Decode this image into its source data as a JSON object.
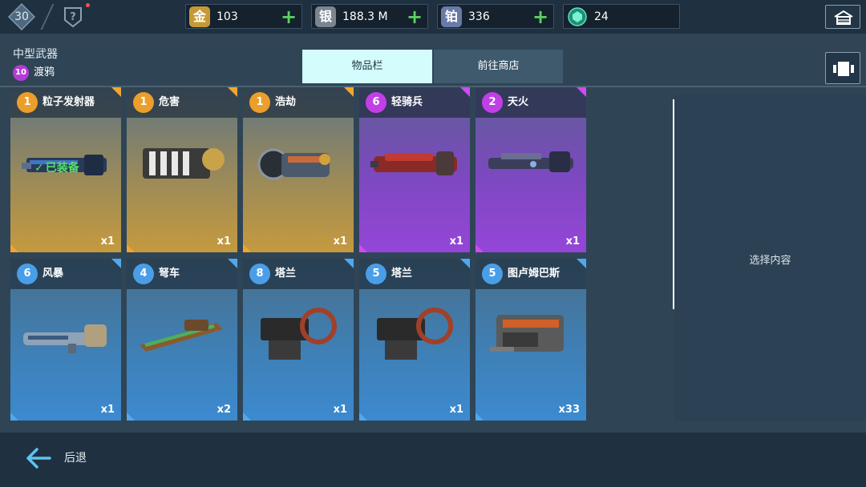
{
  "topbar": {
    "level": "30",
    "currencies": [
      {
        "icon": "金",
        "icon_name": "gold-icon",
        "value": "103"
      },
      {
        "icon": "银",
        "icon_name": "silver-icon",
        "value": "188.3 M"
      },
      {
        "icon": "铂",
        "icon_name": "platinum-icon",
        "value": "336"
      },
      {
        "icon_name": "gem-icon",
        "value": "24"
      }
    ],
    "plus": "+"
  },
  "header": {
    "weapon_type": "中型武器",
    "robot_level": "10",
    "robot_name": "渡鸦"
  },
  "tabs": {
    "inventory": "物品栏",
    "shop": "前往商店"
  },
  "items": [
    {
      "level": "1",
      "name": "粒子发射器",
      "qty": "x1",
      "rarity": "orange",
      "equipped": "已装备"
    },
    {
      "level": "1",
      "name": "危害",
      "qty": "x1",
      "rarity": "orange"
    },
    {
      "level": "1",
      "name": "浩劫",
      "qty": "x1",
      "rarity": "orange"
    },
    {
      "level": "6",
      "name": "轻骑兵",
      "qty": "x1",
      "rarity": "purple"
    },
    {
      "level": "2",
      "name": "天火",
      "qty": "x1",
      "rarity": "purple"
    },
    {
      "level": "6",
      "name": "风暴",
      "qty": "x1",
      "rarity": "blue"
    },
    {
      "level": "4",
      "name": "弩车",
      "qty": "x2",
      "rarity": "blue"
    },
    {
      "level": "8",
      "name": "塔兰",
      "qty": "x1",
      "rarity": "blue"
    },
    {
      "level": "5",
      "name": "塔兰",
      "qty": "x1",
      "rarity": "blue"
    },
    {
      "level": "5",
      "name": "图卢姆巴斯",
      "qty": "x33",
      "rarity": "blue"
    }
  ],
  "detail": {
    "hint": "选择内容"
  },
  "footer": {
    "back_label": "后退"
  },
  "colors": {
    "orange": "#f2a531",
    "purple": "#d04cf0",
    "blue": "#51a8ee",
    "accent_tab": "#d4fcfc",
    "plus_green": "#5bd264",
    "equipped_green": "#55e06a"
  }
}
